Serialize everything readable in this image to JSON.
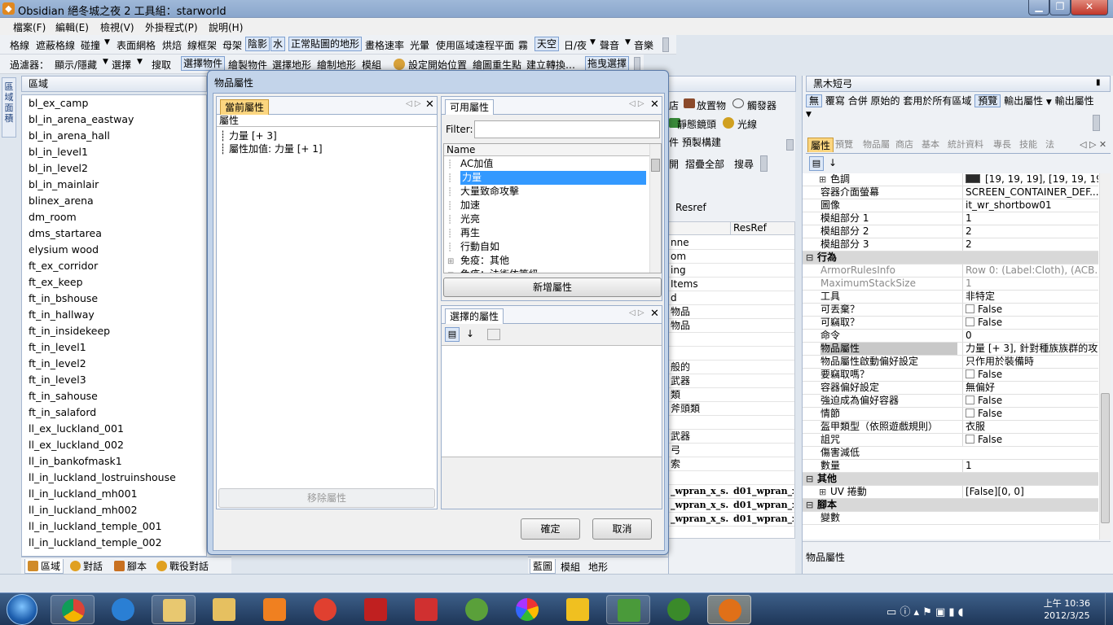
{
  "window": {
    "title": "Obsidian 絕冬城之夜 2 工具組：starworld"
  },
  "menu": [
    "檔案(F)",
    "編輯(E)",
    "檢視(V)",
    "外掛程式(P)",
    "說明(H)"
  ],
  "toolbar1": [
    "格線",
    "遮蔽格線",
    "碰撞",
    "表面網格",
    "烘焙",
    "線框架",
    "母架",
    "陰影",
    "水",
    "正常貼圖的地形",
    "畫格速率",
    "光暈",
    "使用區域遠程平面",
    "霧",
    "天空",
    "日/夜",
    "聲音",
    "音樂"
  ],
  "toolbar2": [
    "過濾器：",
    "顯示/隱藏",
    "選擇",
    "搜取",
    "選擇物件",
    "繪製物件",
    "選擇地形",
    "繪制地形",
    "模組",
    "設定開始位置",
    "繪圖重生點",
    "建立轉換…",
    "拖曳選擇"
  ],
  "left_panel": {
    "vtab": "區域面積",
    "header": "區域",
    "areas": [
      "bl_ex_camp",
      "bl_in_arena_eastway",
      "bl_in_arena_hall",
      "bl_in_level1",
      "bl_in_level2",
      "bl_in_mainlair",
      "blinex_arena",
      "dm_room",
      "dms_startarea",
      "elysium wood",
      "ft_ex_corridor",
      "ft_ex_keep",
      "ft_in_bshouse",
      "ft_in_hallway",
      "ft_in_insidekeep",
      "ft_in_level1",
      "ft_in_level2",
      "ft_in_level3",
      "ft_in_sahouse",
      "ft_in_salaford",
      "ll_ex_luckland_001",
      "ll_ex_luckland_002",
      "ll_in_bankofmask1",
      "ll_in_luckland_lostruinshouse",
      "ll_in_luckland_mh001",
      "ll_in_luckland_mh002",
      "ll_in_luckland_temple_001",
      "ll_in_luckland_temple_002"
    ],
    "tabs": [
      "區域",
      "對話",
      "腳本",
      "戰役對話"
    ]
  },
  "dialog": {
    "title": "物品屬性",
    "current_tab": "當前屬性",
    "current_col": "屬性",
    "current_items": [
      "力量 [+ 3]",
      "屬性加值: 力量 [+ 1]"
    ],
    "remove_btn": "移除屬性",
    "available_tab": "可用屬性",
    "filter_label": "Filter:",
    "filter_value": "",
    "available_col": "Name",
    "available_items": [
      "AC加值",
      "力量",
      "大量致命攻擊",
      "加速",
      "光亮",
      "再生",
      "行動自如",
      "免疫：其他",
      "免疫：法術依等級"
    ],
    "available_selected": 1,
    "add_btn": "新增屬性",
    "selected_tab": "選擇的屬性",
    "ok_btn": "確定",
    "cancel_btn": "取消"
  },
  "middle": {
    "buttons": [
      "放置物",
      "觸發器",
      "靜態鏡頭",
      "光線",
      "預製構建"
    ],
    "bar": [
      "開",
      "摺疊全部",
      "搜尋"
    ],
    "resref_label": "Resref",
    "grid_header": "ResRef",
    "grid_rows": [
      "nne",
      "om",
      "ing",
      "Items",
      "d",
      "物品",
      "物品",
      "",
      "",
      "般的",
      "武器",
      "類",
      "斧頭類",
      "",
      "武器",
      "弓",
      "索",
      "",
      "_wpran_x_s...",
      "_wpran_x_s...",
      "_wpran_x_s..."
    ],
    "grid_col2": [
      "d01_wpran_x_s",
      "d01_wpran_x_s",
      "d01_wpran_x_s"
    ],
    "bottom_tabs": [
      "藍圖",
      "模組",
      "地形"
    ]
  },
  "right": {
    "header": "黑木短弓",
    "toolbar": [
      "無",
      "覆寫",
      "合併",
      "原始的",
      "套用於所有區域",
      "預覽",
      "輸出屬性",
      "輸出屬性"
    ],
    "tabs": [
      "屬性",
      "預覽",
      "物品屬",
      "商店",
      "基本",
      "統計資料",
      "專長",
      "技能",
      "法"
    ],
    "rows": [
      {
        "k": "色調",
        "v": "[19, 19, 19], [19, 19, 19],...",
        "exp": "⊞",
        "swatch": "#2a2a2a"
      },
      {
        "k": "容器介面螢幕",
        "v": "SCREEN_CONTAINER_DEF..."
      },
      {
        "k": "圖像",
        "v": "it_wr_shortbow01"
      },
      {
        "k": "模組部分 1",
        "v": "1"
      },
      {
        "k": "模組部分 2",
        "v": "2"
      },
      {
        "k": "模組部分 3",
        "v": "2"
      },
      {
        "cat": true,
        "k": "行為"
      },
      {
        "k": "ArmorRulesInfo",
        "v": "Row 0:  (Label:Cloth), (ACB...",
        "dim": true
      },
      {
        "k": "MaximumStackSize",
        "v": "1",
        "dim": true
      },
      {
        "k": "工具",
        "v": "非特定"
      },
      {
        "k": "可丟棄？",
        "v": "False",
        "cb": true
      },
      {
        "k": "可竊取？",
        "v": "False",
        "cb": true
      },
      {
        "k": "命令",
        "v": "0"
      },
      {
        "k": "物品屬性",
        "v": "力量 [+ 3], 針對種族族群的攻...",
        "sel": true
      },
      {
        "k": "物品屬性啟動偏好設定",
        "v": "只作用於裝備時"
      },
      {
        "k": "要竊取嗎？",
        "v": "False",
        "cb": true
      },
      {
        "k": "容器偏好設定",
        "v": "無偏好"
      },
      {
        "k": "強迫成為偏好容器",
        "v": "False",
        "cb": true
      },
      {
        "k": "情節",
        "v": "False",
        "cb": true
      },
      {
        "k": "盔甲類型（依照遊戲規則）",
        "v": "衣服"
      },
      {
        "k": "詛咒",
        "v": "False",
        "cb": true
      },
      {
        "k": "傷害減低",
        "v": ""
      },
      {
        "k": "數量",
        "v": "1"
      },
      {
        "cat": true,
        "k": "其他"
      },
      {
        "k": "UV 捲動",
        "v": "[False][0, 0]",
        "exp": "⊞"
      },
      {
        "cat": true,
        "k": "腳本"
      },
      {
        "k": "變數",
        "v": ""
      }
    ],
    "desc_title": "物品屬性"
  },
  "taskbar": {
    "time": "上午 10:36",
    "date": "2012/3/25"
  }
}
